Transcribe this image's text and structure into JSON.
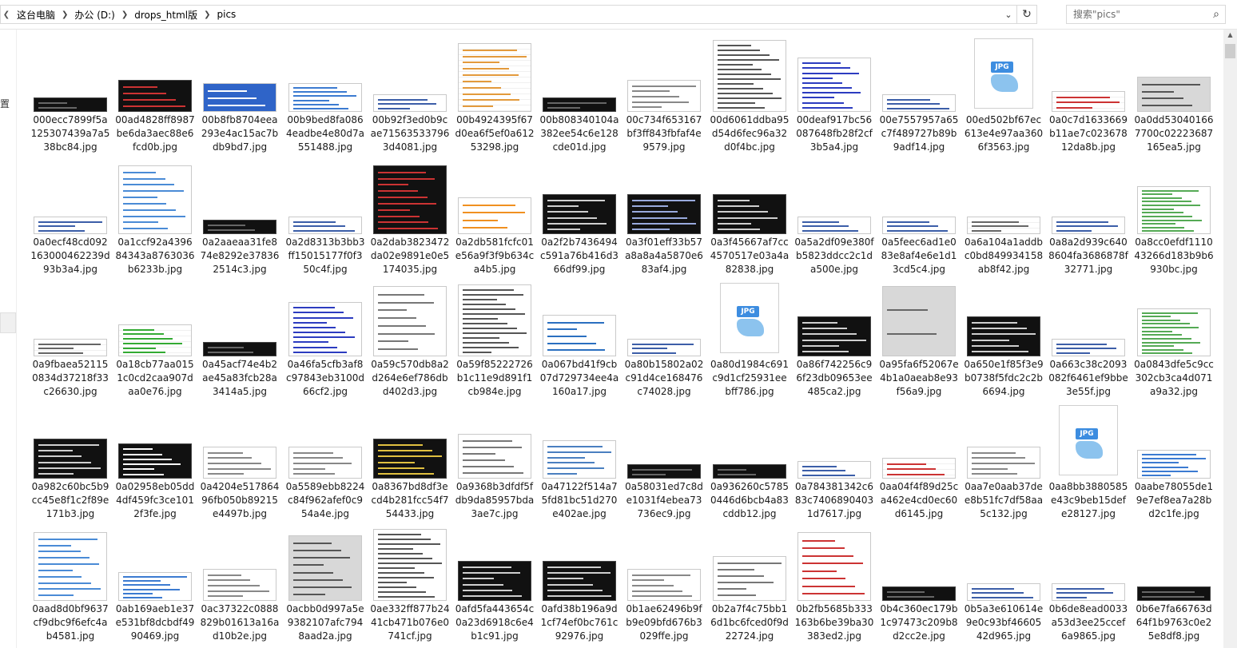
{
  "address_bar": {
    "breadcrumbs": [
      "这台电脑",
      "办公 (D:)",
      "drops_html版",
      "pics"
    ],
    "search_placeholder": "搜索\"pics\""
  },
  "left_pane": {
    "glyph": "置"
  },
  "files": [
    {
      "name": "000ecc7899f5a125307439a7a538bc84.jpg",
      "style": "dark-strip"
    },
    {
      "name": "00ad4828ff8987be6da3aec88e6fcd0b.jpg",
      "style": "terminal-red"
    },
    {
      "name": "00b8fb8704eea293e4ac15ac7bdb9bd7.jpg",
      "style": "red-blue"
    },
    {
      "name": "00b9bed8fa0864eadbe4e80d7a551488.jpg",
      "style": "blue-table"
    },
    {
      "name": "00b92f3ed0b9cae715635337963d4081.jpg",
      "style": "code-short"
    },
    {
      "name": "00b4924395f67d0ea6f5ef0a61253298.jpg",
      "style": "table-orange"
    },
    {
      "name": "00b808340104a382ee54c6e128cde01d.jpg",
      "style": "dark-strip"
    },
    {
      "name": "00c734f653167bf3ff843fbfaf4e9579.jpg",
      "style": "code-light"
    },
    {
      "name": "00d6061ddba95d54d6fec96a32d0f4bc.jpg",
      "style": "text-tall"
    },
    {
      "name": "00deaf917bc56087648fb28f2cf3b5a4.jpg",
      "style": "code-color"
    },
    {
      "name": "00e7557957a65c7f489727b89b9adf14.jpg",
      "style": "code-short"
    },
    {
      "name": "00ed502bf67ec613e4e97aa3606f3563.jpg",
      "style": "jpg-icon"
    },
    {
      "name": "0a0c7d1633669b11ae7c02367812da8b.jpg",
      "style": "table-red"
    },
    {
      "name": "0a0dd530401667700c02223687165ea5.jpg",
      "style": "window-gray"
    },
    {
      "name": "0a0ecf48cd092163000462239d93b3a4.jpg",
      "style": "code-short"
    },
    {
      "name": "0a1ccf92a439684343a8763036b6233b.jpg",
      "style": "blue-list"
    },
    {
      "name": "0a2aaeaa31fe874e8292e378362514c3.jpg",
      "style": "dark-strip"
    },
    {
      "name": "0a2d8313b3bb3ff15015177f0f350c4f.jpg",
      "style": "code-short"
    },
    {
      "name": "0a2dab3823472da02e9891e0e5174035.jpg",
      "style": "dark-tall"
    },
    {
      "name": "0a2db581fcfc01e56a9f3f9b634ca4b5.jpg",
      "style": "app-colorful"
    },
    {
      "name": "0a2f2b7436494c591a76b416d366df99.jpg",
      "style": "terminal"
    },
    {
      "name": "0a3f01eff33b57a8a8a4a5870e683af4.jpg",
      "style": "terminal-dialog"
    },
    {
      "name": "0a3f45667af7cc4570517e03a4a82838.jpg",
      "style": "terminal"
    },
    {
      "name": "0a5a2df09e380fb5823ddcc2c1da500e.jpg",
      "style": "code-short"
    },
    {
      "name": "0a5feec6ad1e083e8af4e6e1d13cd5c4.jpg",
      "style": "code-short"
    },
    {
      "name": "0a6a104a1addbc0bd849934158ab8f42.jpg",
      "style": "table-short"
    },
    {
      "name": "0a8a2d939c6408604fa3686878f32771.jpg",
      "style": "code-short"
    },
    {
      "name": "0a8cc0efdf111043266d183b9b6930bc.jpg",
      "style": "green-text"
    },
    {
      "name": "0a9fbaea521150834d37218f33c26630.jpg",
      "style": "table-short"
    },
    {
      "name": "0a18cb77aa0151c0cd2caa907daa0e76.jpg",
      "style": "green-grid"
    },
    {
      "name": "0a45acf74e4b2ae45a83fcb28a3414a5.jpg",
      "style": "dark-strip"
    },
    {
      "name": "0a46fa5cfb3af8c97843eb3100d66cf2.jpg",
      "style": "code-color"
    },
    {
      "name": "0a59c570db8a2d264e6ef786dbd402d3.jpg",
      "style": "menu-list"
    },
    {
      "name": "0a59f85222726b1c11e9d891f1cb984e.jpg",
      "style": "text-tall"
    },
    {
      "name": "0a067bd41f9cb07d729734ee4a160a17.jpg",
      "style": "browser-blue"
    },
    {
      "name": "0a80b15802a02c91d4ce168476c74028.jpg",
      "style": "code-short"
    },
    {
      "name": "0a80d1984c691c9d1cf25931eebff786.jpg",
      "style": "jpg-icon"
    },
    {
      "name": "0a86f742256c96f23db09653ee485ca2.jpg",
      "style": "terminal"
    },
    {
      "name": "0a95fa6f52067e4b1a0aeab8e93f56a9.jpg",
      "style": "gray-tall"
    },
    {
      "name": "0a650e1f85f3e9b0738f5fdc2c2b6694.jpg",
      "style": "terminal"
    },
    {
      "name": "0a663c38c2093082f6461ef9bbe3e55f.jpg",
      "style": "code-short"
    },
    {
      "name": "0a0843dfe5c9cc302cb3ca4d071a9a32.jpg",
      "style": "green-text"
    },
    {
      "name": "0a982c60bc5b9cc45e8f1c2f89e171b3.jpg",
      "style": "terminal"
    },
    {
      "name": "0a02958eb05dd4df459fc3ce1012f3fe.jpg",
      "style": "dark-ladder"
    },
    {
      "name": "0a4204e51786496fb050b89215e4497b.jpg",
      "style": "code-light"
    },
    {
      "name": "0a5589ebb8224c84f962afef0c954a4e.jpg",
      "style": "code-light"
    },
    {
      "name": "0a8367bd8df3ecd4b281fcc54f754433.jpg",
      "style": "terminal-yellow"
    },
    {
      "name": "0a9368b3dfdf5fdb9da85957bda3ae7c.jpg",
      "style": "diagram"
    },
    {
      "name": "0a47122f514a75fd81bc51d270e402ae.jpg",
      "style": "blue-diagram"
    },
    {
      "name": "0a58031ed7c8de1031f4ebea73736ec9.jpg",
      "style": "dark-strip"
    },
    {
      "name": "0a936260c57850446d6bcb4a83cddb12.jpg",
      "style": "dark-strip"
    },
    {
      "name": "0a784381342c683c74068904031d7617.jpg",
      "style": "code-short"
    },
    {
      "name": "0aa04f4f89d25ca462e4cd0ec60d6145.jpg",
      "style": "table-red"
    },
    {
      "name": "0aa7e0aab37dee8b51fc7df58aa5c132.jpg",
      "style": "code-light"
    },
    {
      "name": "0aa8bb3880585e43c9beb15defe28127.jpg",
      "style": "jpg-icon"
    },
    {
      "name": "0aabe78055de19e7ef8ea7a28bd2c1fe.jpg",
      "style": "blue-table"
    },
    {
      "name": "0aad8d0bf9637cf9dbc9f6efc4ab4581.jpg",
      "style": "blue-list"
    },
    {
      "name": "0ab169aeb1e37e531bf8dcbdf4990469.jpg",
      "style": "blue-table"
    },
    {
      "name": "0ac37322c0888829b01613a16ad10b2e.jpg",
      "style": "code-light"
    },
    {
      "name": "0acbb0d997a5e9382107afc7948aad2a.jpg",
      "style": "dialog-gray"
    },
    {
      "name": "0ae332ff877b2441cb471b076e0741cf.jpg",
      "style": "text-tall"
    },
    {
      "name": "0afd5fa443654c0a23d6918c6e4b1c91.jpg",
      "style": "terminal"
    },
    {
      "name": "0afd38b196a9d1cf74ef0bc761c92976.jpg",
      "style": "terminal"
    },
    {
      "name": "0b1ae62496b9fb9e09bfd676b3029ffe.jpg",
      "style": "code-light"
    },
    {
      "name": "0b2a7f4c75bb16d1bc6fced0f9d22724.jpg",
      "style": "diagram"
    },
    {
      "name": "0b2fb5685b333163b6be39ba30383ed2.jpg",
      "style": "red-web"
    },
    {
      "name": "0b4c360ec179b1c97473c209b8d2cc2e.jpg",
      "style": "dark-strip"
    },
    {
      "name": "0b5a3e610614e9e0c93bf4660542d965.jpg",
      "style": "code-short"
    },
    {
      "name": "0b6de8ead0033a53d3ee25ccef6a9865.jpg",
      "style": "code-short"
    },
    {
      "name": "0b6e7fa66763d64f1b9763c0e25e8df8.jpg",
      "style": "dark-strip"
    }
  ]
}
